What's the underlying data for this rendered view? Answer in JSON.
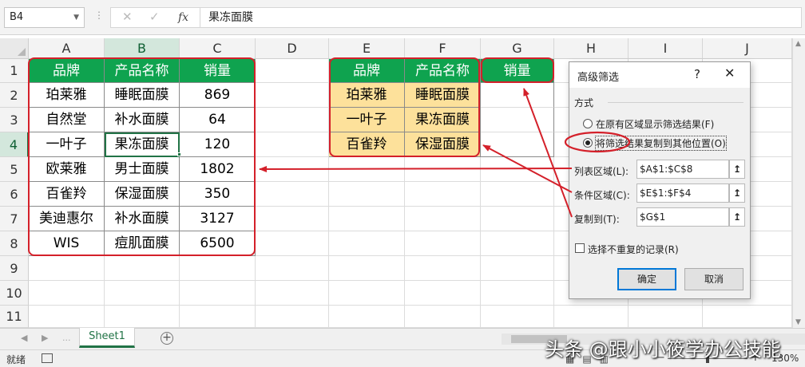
{
  "formula_bar": {
    "name_box": "B4",
    "content": "果冻面膜",
    "cancel_icon": "x-icon",
    "enter_icon": "check-icon",
    "fx_label": "fx"
  },
  "sheet": {
    "columns": [
      "A",
      "B",
      "C",
      "D",
      "E",
      "F",
      "G",
      "H",
      "I",
      "J"
    ],
    "rows": [
      "1",
      "2",
      "3",
      "4",
      "5",
      "6",
      "7",
      "8",
      "9",
      "10",
      "11"
    ],
    "selected_cell": "B4",
    "header_color": "#0fa34f",
    "criteria_fill": "#fde19b",
    "highlight_color": "#d4202a",
    "source_table": {
      "headers": [
        "品牌",
        "产品名称",
        "销量"
      ],
      "rows": [
        [
          "珀莱雅",
          "睡眠面膜",
          "869"
        ],
        [
          "自然堂",
          "补水面膜",
          "64"
        ],
        [
          "一叶子",
          "果冻面膜",
          "120"
        ],
        [
          "欧莱雅",
          "男士面膜",
          "1802"
        ],
        [
          "百雀羚",
          "保湿面膜",
          "350"
        ],
        [
          "美迪惠尔",
          "补水面膜",
          "3127"
        ],
        [
          "WIS",
          "痘肌面膜",
          "6500"
        ]
      ]
    },
    "criteria_table": {
      "headers": [
        "品牌",
        "产品名称"
      ],
      "rows": [
        [
          "珀莱雅",
          "睡眠面膜"
        ],
        [
          "一叶子",
          "果冻面膜"
        ],
        [
          "百雀羚",
          "保湿面膜"
        ]
      ]
    },
    "output_header": "销量"
  },
  "dialog": {
    "title": "高级筛选",
    "help": "?",
    "close": "✕",
    "section": "方式",
    "option_in_place": "在原有区域显示筛选结果(F)",
    "option_copy": "将筛选结果复制到其他位置(O)",
    "list_range_label": "列表区域(L):",
    "list_range_value": "$A$1:$C$8",
    "criteria_range_label": "条件区域(C):",
    "criteria_range_value": "$E$1:$F$4",
    "copy_to_label": "复制到(T):",
    "copy_to_value": "$G$1",
    "unique_label": "选择不重复的记录(R)",
    "ok": "确定",
    "cancel": "取消"
  },
  "tabs": {
    "sheet": "Sheet1",
    "nav_dots": "...",
    "add_icon": "plus-circle-icon"
  },
  "status": {
    "ready": "就绪",
    "zoom": "130%"
  },
  "watermark": "头条 @跟小小筱学办公技能"
}
